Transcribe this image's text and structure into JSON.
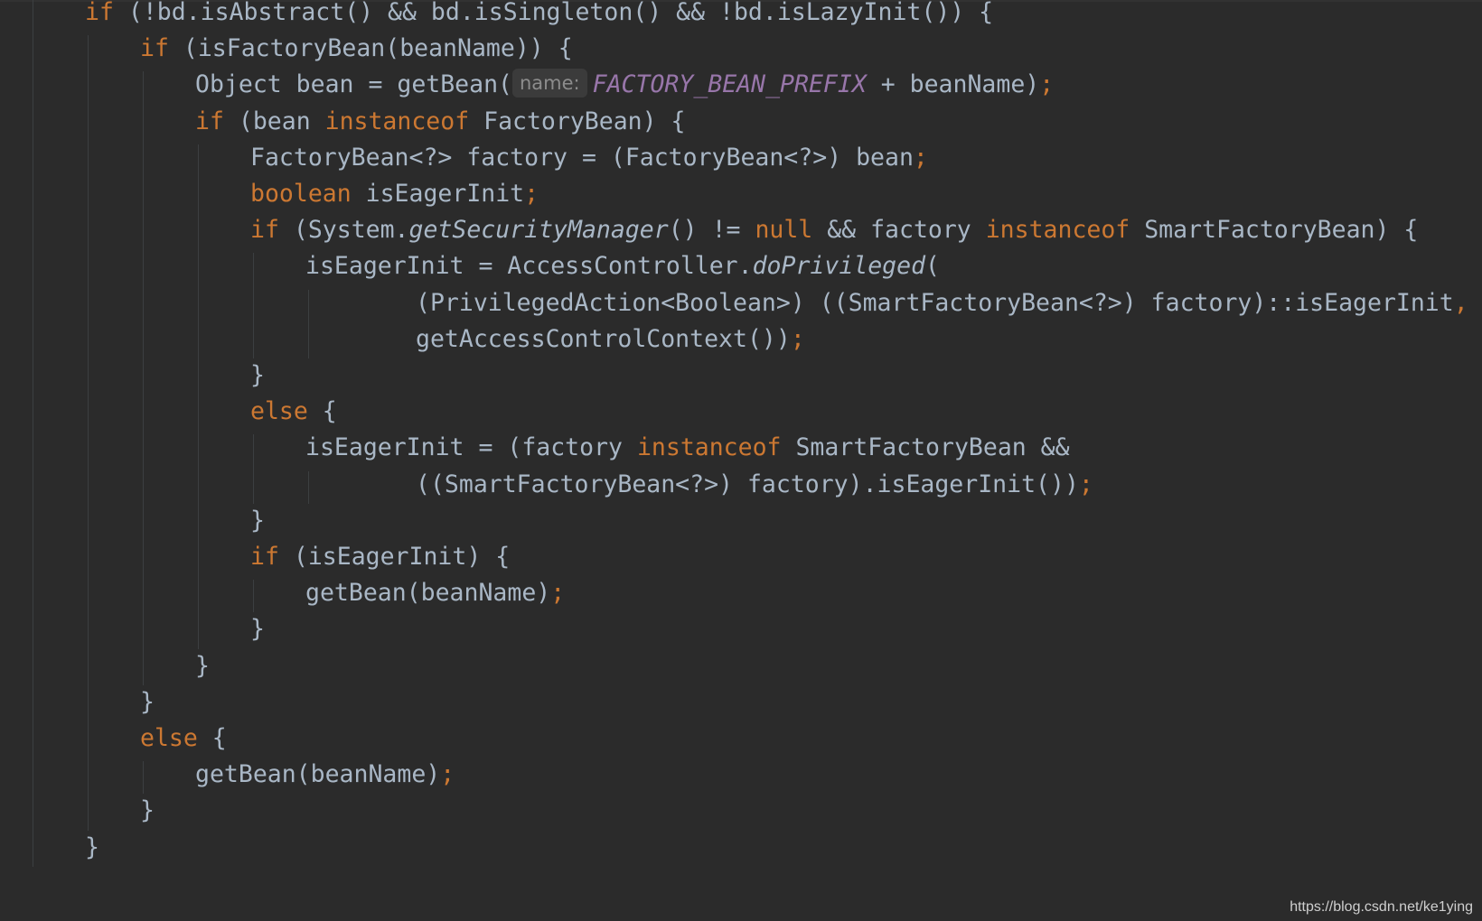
{
  "editor": {
    "theme_colors": {
      "background": "#2b2b2b",
      "keyword": "#cc7832",
      "identifier": "#a9b7c6",
      "constant": "#9876aa",
      "hint": "#8c8c8c",
      "indent_guide": "#3c3f41"
    },
    "lines": [
      {
        "indent": 0,
        "tokens": [
          {
            "t": "if",
            "c": "kw"
          },
          {
            "t": " (!bd.isAbstract() && bd.isSingleton() && !bd.isLazyInit()) {",
            "c": "plain"
          }
        ]
      },
      {
        "indent": 1,
        "tokens": [
          {
            "t": "if",
            "c": "kw"
          },
          {
            "t": " (isFactoryBean(beanName)) {",
            "c": "plain"
          }
        ]
      },
      {
        "indent": 2,
        "tokens": [
          {
            "t": "Object bean = getBean(",
            "c": "plain"
          },
          {
            "t": "name:",
            "c": "hint"
          },
          {
            "t": "FACTORY_BEAN_PREFIX",
            "c": "const"
          },
          {
            "t": " + beanName)",
            "c": "plain"
          },
          {
            "t": ";",
            "c": "punct"
          }
        ]
      },
      {
        "indent": 2,
        "tokens": [
          {
            "t": "if",
            "c": "kw"
          },
          {
            "t": " (bean ",
            "c": "plain"
          },
          {
            "t": "instanceof",
            "c": "kw"
          },
          {
            "t": " FactoryBean) {",
            "c": "plain"
          }
        ]
      },
      {
        "indent": 3,
        "tokens": [
          {
            "t": "FactoryBean<?> factory = (FactoryBean<?>) bean",
            "c": "plain"
          },
          {
            "t": ";",
            "c": "punct"
          }
        ]
      },
      {
        "indent": 3,
        "tokens": [
          {
            "t": "boolean",
            "c": "kw"
          },
          {
            "t": " isEagerInit",
            "c": "plain"
          },
          {
            "t": ";",
            "c": "punct"
          }
        ]
      },
      {
        "indent": 3,
        "tokens": [
          {
            "t": "if",
            "c": "kw"
          },
          {
            "t": " (System.",
            "c": "plain"
          },
          {
            "t": "getSecurityManager",
            "c": "italic"
          },
          {
            "t": "() != ",
            "c": "plain"
          },
          {
            "t": "null",
            "c": "kw"
          },
          {
            "t": " && factory ",
            "c": "plain"
          },
          {
            "t": "instanceof",
            "c": "kw"
          },
          {
            "t": " SmartFactoryBean) {",
            "c": "plain"
          }
        ]
      },
      {
        "indent": 4,
        "tokens": [
          {
            "t": "isEagerInit = AccessController.",
            "c": "plain"
          },
          {
            "t": "doPrivileged",
            "c": "italic"
          },
          {
            "t": "(",
            "c": "plain"
          }
        ]
      },
      {
        "indent": 6,
        "tokens": [
          {
            "t": "(PrivilegedAction<Boolean>) ((SmartFactoryBean<?>) factory)::isEagerInit",
            "c": "plain"
          },
          {
            "t": ",",
            "c": "punct"
          }
        ]
      },
      {
        "indent": 6,
        "tokens": [
          {
            "t": "getAccessControlContext())",
            "c": "plain"
          },
          {
            "t": ";",
            "c": "punct"
          }
        ]
      },
      {
        "indent": 3,
        "tokens": [
          {
            "t": "}",
            "c": "plain"
          }
        ]
      },
      {
        "indent": 3,
        "tokens": [
          {
            "t": "else",
            "c": "kw"
          },
          {
            "t": " {",
            "c": "plain"
          }
        ]
      },
      {
        "indent": 4,
        "tokens": [
          {
            "t": "isEagerInit = (factory ",
            "c": "plain"
          },
          {
            "t": "instanceof",
            "c": "kw"
          },
          {
            "t": " SmartFactoryBean &&",
            "c": "plain"
          }
        ]
      },
      {
        "indent": 6,
        "tokens": [
          {
            "t": "((SmartFactoryBean<?>) factory).isEagerInit())",
            "c": "plain"
          },
          {
            "t": ";",
            "c": "punct"
          }
        ]
      },
      {
        "indent": 3,
        "tokens": [
          {
            "t": "}",
            "c": "plain"
          }
        ]
      },
      {
        "indent": 3,
        "tokens": [
          {
            "t": "if",
            "c": "kw"
          },
          {
            "t": " (isEagerInit) {",
            "c": "plain"
          }
        ]
      },
      {
        "indent": 4,
        "tokens": [
          {
            "t": "getBean(beanName)",
            "c": "plain"
          },
          {
            "t": ";",
            "c": "punct"
          }
        ]
      },
      {
        "indent": 3,
        "tokens": [
          {
            "t": "}",
            "c": "plain"
          }
        ]
      },
      {
        "indent": 2,
        "tokens": [
          {
            "t": "}",
            "c": "plain"
          }
        ]
      },
      {
        "indent": 1,
        "tokens": [
          {
            "t": "}",
            "c": "plain"
          }
        ]
      },
      {
        "indent": 1,
        "tokens": [
          {
            "t": "else",
            "c": "kw"
          },
          {
            "t": " {",
            "c": "plain"
          }
        ]
      },
      {
        "indent": 2,
        "tokens": [
          {
            "t": "getBean(beanName)",
            "c": "plain"
          },
          {
            "t": ";",
            "c": "punct"
          }
        ]
      },
      {
        "indent": 1,
        "tokens": [
          {
            "t": "}",
            "c": "plain"
          }
        ]
      },
      {
        "indent": 0,
        "tokens": [
          {
            "t": "}",
            "c": "plain"
          }
        ]
      }
    ]
  },
  "watermark": {
    "text": "https://blog.csdn.net/ke1ying"
  }
}
